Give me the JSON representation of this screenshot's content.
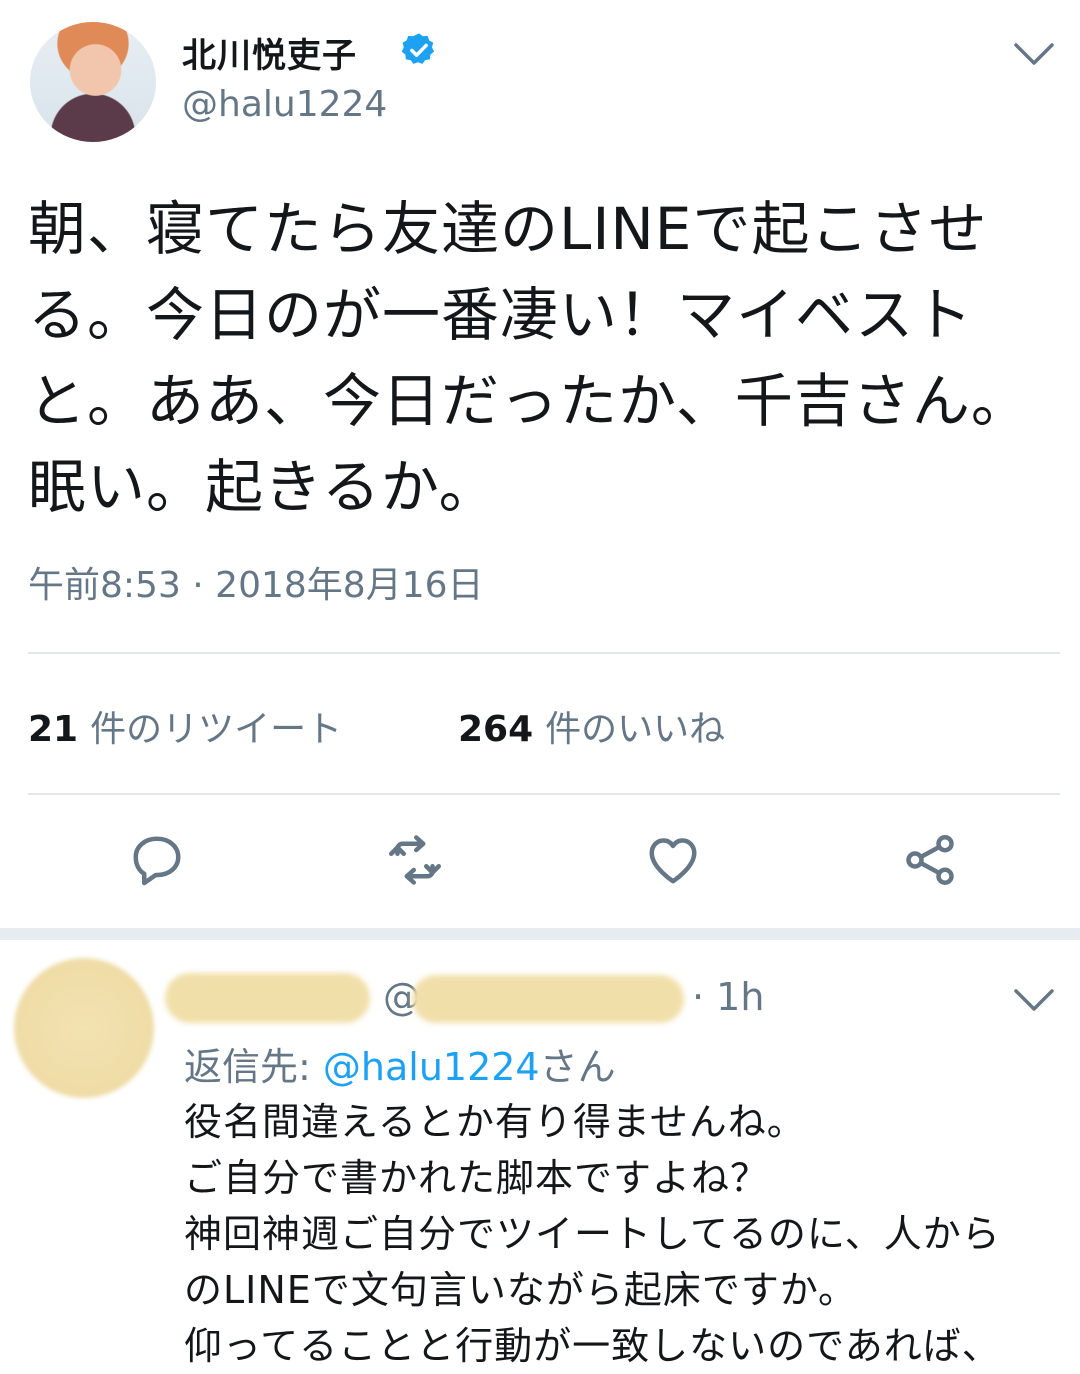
{
  "tweet": {
    "author_name": "北川悦吏子",
    "author_handle": "@halu1224",
    "text": "朝、寝てたら友達のLINEで起こさせる。今日のが一番凄い！マイベストと。ああ、今日だったか、千吉さん。眠い。起きるか。",
    "timestamp": "午前8:53 · 2018年8月16日",
    "retweets_count": "21",
    "retweets_label": "件のリツイート",
    "likes_count": "264",
    "likes_label": "件のいいね",
    "actions": [
      "reply-icon",
      "retweet-icon",
      "like-icon",
      "share-icon"
    ]
  },
  "reply": {
    "at_sign": "@",
    "time": "· 1h",
    "reply_to_prefix": "返信先: ",
    "reply_to_handle": "@halu1224",
    "reply_to_suffix": "さん",
    "text": "役名間違えるとか有り得ませんね。\nご自分で書かれた脚本ですよね？\n神回神週ご自分でツイートしてるのに、人から\nのLINEで文句言いながら起床ですか。\n仰ってることと行動が一致しないのであれば、"
  },
  "colors": {
    "accent": "#1da1f2",
    "secondary_text": "#657786",
    "divider": "#e1e8ed"
  }
}
